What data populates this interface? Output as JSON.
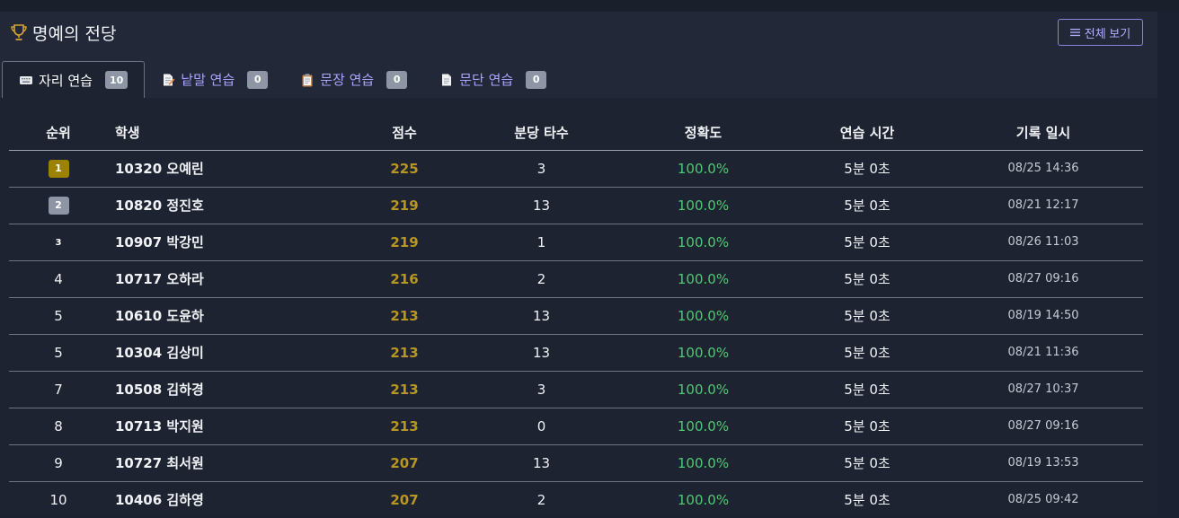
{
  "header": {
    "icon": "trophy-icon",
    "title": "명예의 전당",
    "view_all_label": "전체 보기",
    "view_all_icon": "list-icon"
  },
  "tabs": [
    {
      "icon": "keyboard-icon",
      "label": "자리 연습",
      "count": "10",
      "active": true
    },
    {
      "icon": "memo-icon",
      "label": "낱말 연습",
      "count": "0",
      "active": false
    },
    {
      "icon": "clipboard-icon",
      "label": "문장 연습",
      "count": "0",
      "active": false
    },
    {
      "icon": "page-icon",
      "label": "문단 연습",
      "count": "0",
      "active": false
    }
  ],
  "table": {
    "headers": [
      "순위",
      "학생",
      "점수",
      "분당 타수",
      "정확도",
      "연습 시간",
      "기록 일시"
    ],
    "rows": [
      {
        "rank": "1",
        "student": "10320 오예린",
        "score": "225",
        "wpm": "3",
        "accuracy": "100.0%",
        "time": "5분 0초",
        "date": "08/25 14:36"
      },
      {
        "rank": "2",
        "student": "10820 정진호",
        "score": "219",
        "wpm": "13",
        "accuracy": "100.0%",
        "time": "5분 0초",
        "date": "08/21 12:17"
      },
      {
        "rank": "3",
        "student": "10907 박강민",
        "score": "219",
        "wpm": "1",
        "accuracy": "100.0%",
        "time": "5분 0초",
        "date": "08/26 11:03"
      },
      {
        "rank": "4",
        "student": "10717 오하라",
        "score": "216",
        "wpm": "2",
        "accuracy": "100.0%",
        "time": "5분 0초",
        "date": "08/27 09:16"
      },
      {
        "rank": "5",
        "student": "10610 도윤하",
        "score": "213",
        "wpm": "13",
        "accuracy": "100.0%",
        "time": "5분 0초",
        "date": "08/19 14:50"
      },
      {
        "rank": "5",
        "student": "10304 김상미",
        "score": "213",
        "wpm": "13",
        "accuracy": "100.0%",
        "time": "5분 0초",
        "date": "08/21 11:36"
      },
      {
        "rank": "7",
        "student": "10508 김하경",
        "score": "213",
        "wpm": "3",
        "accuracy": "100.0%",
        "time": "5분 0초",
        "date": "08/27 10:37"
      },
      {
        "rank": "8",
        "student": "10713 박지원",
        "score": "213",
        "wpm": "0",
        "accuracy": "100.0%",
        "time": "5분 0초",
        "date": "08/27 09:16"
      },
      {
        "rank": "9",
        "student": "10727 최서원",
        "score": "207",
        "wpm": "13",
        "accuracy": "100.0%",
        "time": "5분 0초",
        "date": "08/19 13:53"
      },
      {
        "rank": "10",
        "student": "10406 김하영",
        "score": "207",
        "wpm": "2",
        "accuracy": "100.0%",
        "time": "5분 0초",
        "date": "08/25 09:42"
      }
    ]
  },
  "colors": {
    "background": "#1d2331",
    "header_bg": "#222838",
    "accent": "#a9a4ff",
    "score": "#b89622",
    "accuracy": "#52c873",
    "gold": "#9c8200",
    "silver": "#8e96a6"
  }
}
